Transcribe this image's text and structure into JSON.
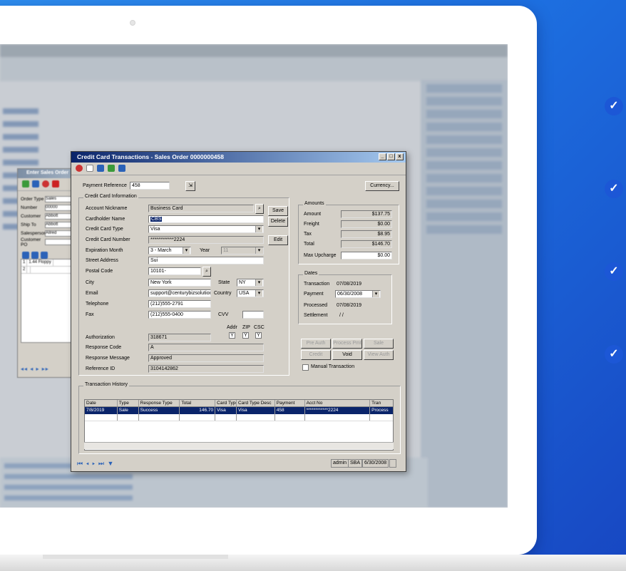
{
  "win": {
    "title": "Credit Card Transactions - Sales Order 0000000458",
    "payment_reference_label": "Payment Reference",
    "payment_reference": "458",
    "currency_button": "Currency...",
    "cc_group_label": "Credit Card Information",
    "fields": {
      "account_nickname_label": "Account Nickname",
      "account_nickname": "Business Card",
      "cardholder_name_label": "Cardholder Name",
      "cardholder_name": "CBS",
      "card_type_label": "Credit Card Type",
      "card_type": "Visa",
      "card_number_label": "Credit Card Number",
      "card_number": "************2224",
      "expiration_month_label": "Expiration Month",
      "expiration_month": "3 - March",
      "year_label": "Year",
      "year": "11",
      "street_address_label": "Street Address",
      "street_address": "Sui",
      "postal_code_label": "Postal Code",
      "postal_code": "10101-",
      "city_label": "City",
      "city": "New York",
      "state_label": "State",
      "state": "NY",
      "email_label": "Email",
      "email": "support@centurybizsolution",
      "country_label": "Country",
      "country": "USA",
      "telephone_label": "Telephone",
      "telephone": "(212)555-2791",
      "fax_label": "Fax",
      "fax": "(212)555-0400",
      "cvv_label": "CVV",
      "cvv": ""
    },
    "buttons": {
      "save": "Save",
      "delete": "Delete",
      "edit": "Edit",
      "pre_auth": "Pre Auth",
      "process_pmt": "Process Pmt",
      "sale": "Sale",
      "credit": "Credit",
      "void": "Void",
      "view_auth": "View Auth"
    },
    "auth": {
      "authorization_label": "Authorization",
      "authorization": "318671",
      "addr_label": "Addr",
      "zip_label": "ZIP",
      "csc_label": "CSC",
      "addr": "Y",
      "zip": "Y",
      "csc": "Y",
      "response_code_label": "Response Code",
      "response_code": "A",
      "response_message_label": "Response Message",
      "response_message": "Approved",
      "reference_id_label": "Reference ID",
      "reference_id": "3104142862"
    },
    "amounts": {
      "group_label": "Amounts",
      "amount_label": "Amount",
      "amount": "$137.75",
      "freight_label": "Freight",
      "freight": "$0.00",
      "tax_label": "Tax",
      "tax": "$8.95",
      "total_label": "Total",
      "total": "$146.70",
      "max_upcharge_label": "Max Upcharge",
      "max_upcharge": "$0.00"
    },
    "dates": {
      "group_label": "Dates",
      "transaction_label": "Transaction",
      "transaction": "07/08/2019",
      "payment_label": "Payment",
      "payment": "06/30/2008",
      "processed_label": "Processed",
      "processed": "07/08/2019",
      "settlement_label": "Settlement",
      "settlement": "/ /"
    },
    "manual_transaction": "Manual Transaction",
    "history": {
      "group_label": "Transaction History",
      "columns": [
        "Date",
        "Type",
        "Response Type",
        "Total",
        "Card Type",
        "Card Type Desc",
        "Payment",
        "Acct No",
        "Tran"
      ],
      "rows": [
        [
          "7/8/2019",
          "Sale",
          "Success",
          "146.70",
          "Visa",
          "Visa",
          "458",
          "************2224",
          "Process"
        ]
      ]
    },
    "status": {
      "user": "admin",
      "company": "SBA",
      "date": "6/30/2008"
    }
  },
  "sales_order": {
    "title": "Enter Sales Order",
    "fields": [
      {
        "label": "Order Type",
        "value": "Sales"
      },
      {
        "label": "Number",
        "value": "00000"
      },
      {
        "label": "Customer",
        "value": "Abbott"
      },
      {
        "label": "Ship To",
        "value": "Abbott"
      },
      {
        "label": "Salesperson",
        "value": "Allred"
      },
      {
        "label": "Customer PO",
        "value": ""
      }
    ],
    "grid_rows": [
      [
        "1",
        "1.44 Floppy"
      ],
      [
        "2",
        ""
      ]
    ]
  },
  "icons": [
    "check-icon",
    "save-icon",
    "delete-icon",
    "globe-icon",
    "print-icon",
    "filter-icon"
  ],
  "colors": {
    "brand_blue": "#1d6fe0",
    "check_blue": "#1c57d6",
    "title_bar": "#0a246a"
  }
}
